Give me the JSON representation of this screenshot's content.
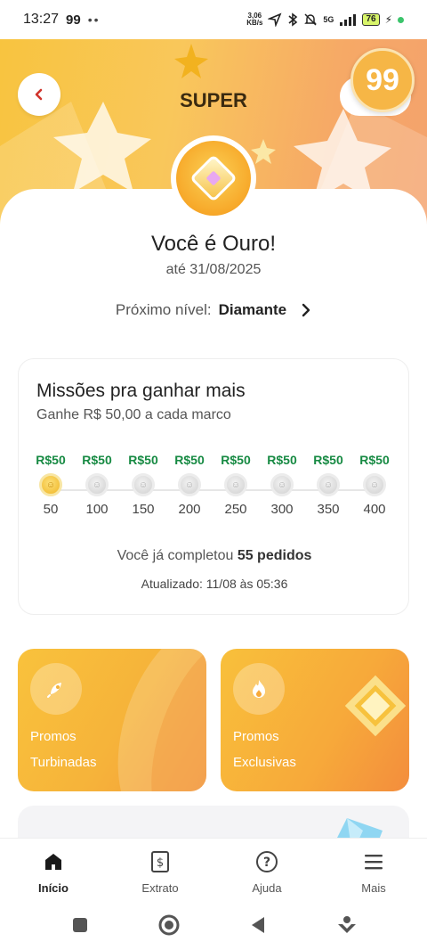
{
  "status_bar": {
    "time": "13:27",
    "app_badge": "99",
    "notif_dots": "••",
    "net_speed_value": "3,06",
    "net_speed_unit": "KB/s",
    "network": "5G",
    "battery": "76"
  },
  "header": {
    "title": "SUPER",
    "back_icon": "chevron-left-icon",
    "logo_text": "99"
  },
  "tier": {
    "title": "Você é Ouro!",
    "valid_until": "até 31/08/2025",
    "next_level_label": "Próximo nível:",
    "next_level_value": "Diamante",
    "next_icon": "chevron-right-icon"
  },
  "missions": {
    "title": "Missões pra ganhar mais",
    "subtitle": "Ganhe R$ 50,00 a cada marco",
    "milestones": [
      {
        "reward": "R$50",
        "target": "50",
        "achieved": true
      },
      {
        "reward": "R$50",
        "target": "100",
        "achieved": false
      },
      {
        "reward": "R$50",
        "target": "150",
        "achieved": false
      },
      {
        "reward": "R$50",
        "target": "200",
        "achieved": false
      },
      {
        "reward": "R$50",
        "target": "250",
        "achieved": false
      },
      {
        "reward": "R$50",
        "target": "300",
        "achieved": false
      },
      {
        "reward": "R$50",
        "target": "350",
        "achieved": false
      },
      {
        "reward": "R$50",
        "target": "400",
        "achieved": false
      }
    ],
    "completed_prefix": "Você já completou",
    "completed_value": "55 pedidos",
    "updated": "Atualizado: 11/08 às 05:36"
  },
  "promos": [
    {
      "line1": "Promos",
      "line2": "Turbinadas",
      "icon": "rocket-icon"
    },
    {
      "line1": "Promos",
      "line2": "Exclusivas",
      "icon": "flame-icon"
    }
  ],
  "tabs": [
    {
      "label": "Início",
      "icon": "home-icon",
      "active": true
    },
    {
      "label": "Extrato",
      "icon": "receipt-icon",
      "active": false
    },
    {
      "label": "Ajuda",
      "icon": "help-icon",
      "active": false
    },
    {
      "label": "Mais",
      "icon": "menu-icon",
      "active": false
    }
  ],
  "colors": {
    "accent_gold": "#f8c43f",
    "reward_green": "#178a43",
    "back_red": "#d0342c"
  }
}
